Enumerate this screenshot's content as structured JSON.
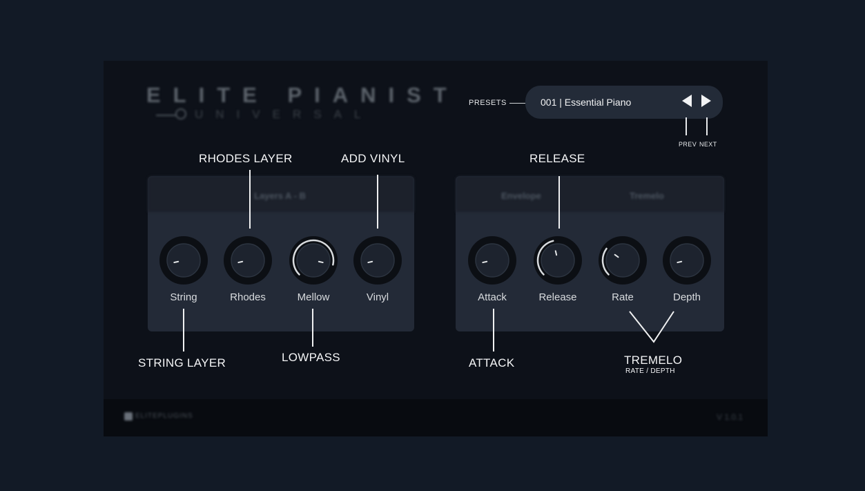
{
  "app": {
    "title": "ELITE PIANIST",
    "subtitle": "UNIVERSAL",
    "version": "V 1.0.1",
    "brand": "ELITEPLUGINS"
  },
  "presets": {
    "label": "PRESETS",
    "current": "001 | Essential Piano",
    "prev_label": "PREV",
    "next_label": "NEXT"
  },
  "panels": {
    "layers_title": "Layers A - B",
    "envelope_title": "Envelope",
    "tremelo_title": "Tremelo"
  },
  "knobs": [
    {
      "label": "String",
      "value": 0.12,
      "icon": "rotary-knob"
    },
    {
      "label": "Rhodes",
      "value": 0.12,
      "icon": "rotary-knob"
    },
    {
      "label": "Mellow",
      "value": 0.88,
      "icon": "rotary-knob"
    },
    {
      "label": "Vinyl",
      "value": 0.12,
      "icon": "rotary-knob"
    },
    {
      "label": "Attack",
      "value": 0.12,
      "icon": "rotary-knob"
    },
    {
      "label": "Release",
      "value": 0.45,
      "icon": "rotary-knob"
    },
    {
      "label": "Rate",
      "value": 0.3,
      "icon": "rotary-knob"
    },
    {
      "label": "Depth",
      "value": 0.12,
      "icon": "rotary-knob"
    }
  ],
  "annotations": {
    "rhodes_layer": "RHODES LAYER",
    "add_vinyl": "ADD VINYL",
    "release": "RELEASE",
    "string_layer": "STRING LAYER",
    "lowpass": "LOWPASS",
    "attack": "ATTACK",
    "tremelo": "TREMELO",
    "tremelo_sub": "RATE / DEPTH"
  },
  "colors": {
    "background": "#121a26",
    "panel": "#232a37",
    "knob_arc": "#d9dcdf",
    "text": "#f4f5f6"
  }
}
